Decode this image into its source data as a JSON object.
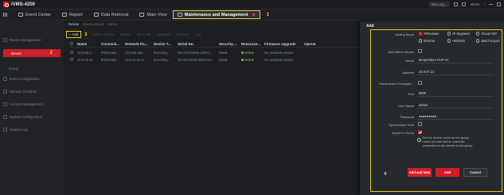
{
  "app": {
    "title": "iVMS-4200",
    "user_area": "Net Log...",
    "user": "admin"
  },
  "menu": {
    "tabs": [
      {
        "label": "Event Center"
      },
      {
        "label": "Report"
      },
      {
        "label": "Data Retrieval"
      },
      {
        "label": "Main View"
      },
      {
        "label": "Maintenance and Management"
      }
    ],
    "step_label": "1"
  },
  "sidebar": {
    "items": [
      {
        "label": "Device Management"
      },
      {
        "label": "Device",
        "step": "2"
      },
      {
        "label": "Group"
      },
      {
        "label": "Event Configuration"
      },
      {
        "label": "Storage Schedule"
      },
      {
        "label": "Account Management"
      },
      {
        "label": "System Configuration"
      },
      {
        "label": "System Log"
      }
    ]
  },
  "main": {
    "tabs": [
      "Device",
      "Device Model",
      "Server"
    ],
    "toolbar": {
      "add_label": "Add",
      "step_label": "3",
      "buttons": [
        "Online Device",
        "Delete",
        "QR Code",
        "Upgrade",
        "Refresh",
        "Log"
      ]
    },
    "table": {
      "columns": [
        "Name",
        "Connecti...",
        "Network Pa...",
        "Device T...",
        "Serial No.",
        "Security ...",
        "Resource...",
        "Firmware Upgrade",
        "Operat"
      ],
      "rows": [
        [
          "10.9.96.1...",
          "IP/Domain",
          "10.9.96.181...",
          "Encoding...",
          "DS-2TD2636B-15/P2...",
          "Weak",
          "Online",
          "No available device",
          ""
        ],
        [
          "10.9.31.51",
          "IP/Domain",
          "10.9.31.51:8...",
          "Encoding...",
          "DS-6612DXD-B6/0116...",
          "Weak",
          "Online",
          "No available device",
          ""
        ]
      ]
    }
  },
  "add_panel": {
    "title": "Add",
    "adding_mode_label": "Adding Mode",
    "modes": [
      "IP/Domain",
      "IP Segment",
      "Cloud P2P",
      "EHome",
      "HiDDNS",
      "Batch Import"
    ],
    "add_offline_label": "Add Offline Device",
    "name_label": "Name",
    "name_value": "temperature DVR ne",
    "address_label": "Address",
    "address_value": "10.9.97.21",
    "transmission_label": "Transmission Encryptio...",
    "port_label": "Port",
    "port_value": "8000",
    "username_label": "User Name",
    "username_value": "admin",
    "password_label": "Password",
    "password_value": "●●●●●●●●●",
    "sync_time_label": "Synchronize Time",
    "import_group_label": "Import to Group",
    "info_text": "Set the device name as the group name and add all the channels connected to the device to the group.",
    "step_label": "4",
    "add_and_new_label": "Add and New",
    "add_label": "Add",
    "cancel_label": "Cancel"
  }
}
